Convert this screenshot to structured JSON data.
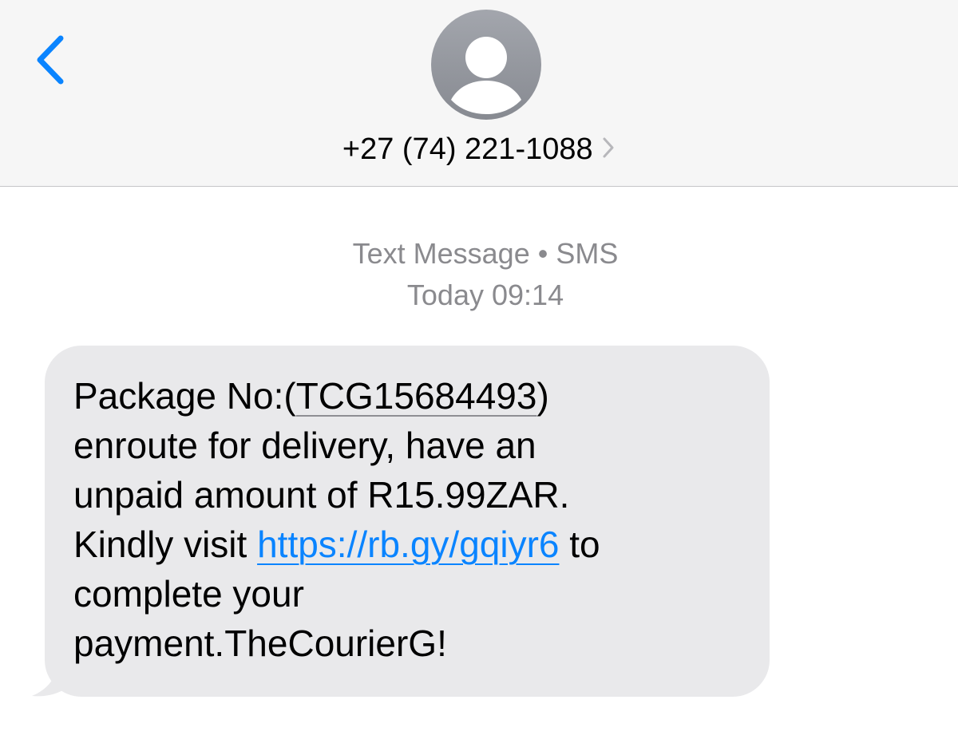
{
  "header": {
    "contact": "+27 (74) 221-1088",
    "back_icon": "chevron-left-icon",
    "contact_chevron_icon": "chevron-right-icon",
    "avatar_icon": "person-icon"
  },
  "conversation": {
    "service_label": "Text Message",
    "separator": "•",
    "service_type": "SMS",
    "day": "Today",
    "time": "09:14"
  },
  "message": {
    "prefix": "Package No:(",
    "tracking_number": "TCG15684493",
    "suffix": ")",
    "line2": "enroute for delivery, have an",
    "line3": "unpaid amount of R15.99ZAR.",
    "line4_before_link": "Kindly visit ",
    "link": "https://rb.gy/gqiyr6",
    "line4_after_link": " to",
    "line5": "complete your",
    "line6": "payment.TheCourierG!"
  },
  "colors": {
    "accent": "#0a84ff",
    "header_bg": "#f6f6f6",
    "bubble_bg": "#e9e9eb",
    "meta_text": "#8a8a8e",
    "avatar_bg": "#8e9097"
  }
}
